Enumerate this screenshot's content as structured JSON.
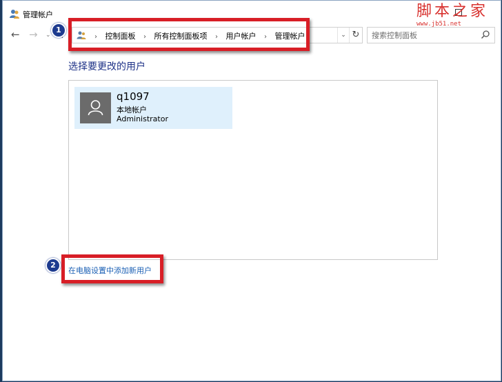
{
  "window": {
    "title": "管理帐户",
    "icons": {
      "title": "user-accounts-icon",
      "maximize": "maximize-icon"
    }
  },
  "watermark": {
    "text": "脚本之家",
    "url": "www.jb51.net",
    "color": "#d8312e"
  },
  "nav": {
    "back": "←",
    "forward": "→",
    "recent": "⌄",
    "up": "↑",
    "icons": {
      "back": "arrow-left-icon",
      "forward": "arrow-right-icon",
      "recent": "chevron-down-icon",
      "up": "arrow-up-icon"
    }
  },
  "addressbar": {
    "breadcrumbs": [
      "控制面板",
      "所有控制面板项",
      "用户帐户",
      "管理帐户"
    ],
    "separator": "›",
    "dropdown": "⌄",
    "refresh": "↻",
    "icons": {
      "location": "control-panel-icon",
      "dropdown": "chevron-down-icon",
      "refresh": "refresh-icon"
    }
  },
  "search": {
    "placeholder": "搜索控制面板",
    "value": "",
    "icon": "search-icon"
  },
  "main": {
    "heading": "选择要更改的用户",
    "users": [
      {
        "name": "q1097",
        "type": "本地帐户",
        "role": "Administrator",
        "avatar_icon": "user-avatar-icon"
      }
    ],
    "add_user_link": "在电脑设置中添加新用户"
  },
  "annotations": {
    "markers": [
      "1",
      "2"
    ],
    "box_color": "#d81e26",
    "marker_color": "#1d3b8f"
  },
  "colors": {
    "heading": "#1e3287",
    "link": "#1a5fb4",
    "tile_selected": "#dff0fc",
    "avatar_bg": "#6b6b6b"
  }
}
